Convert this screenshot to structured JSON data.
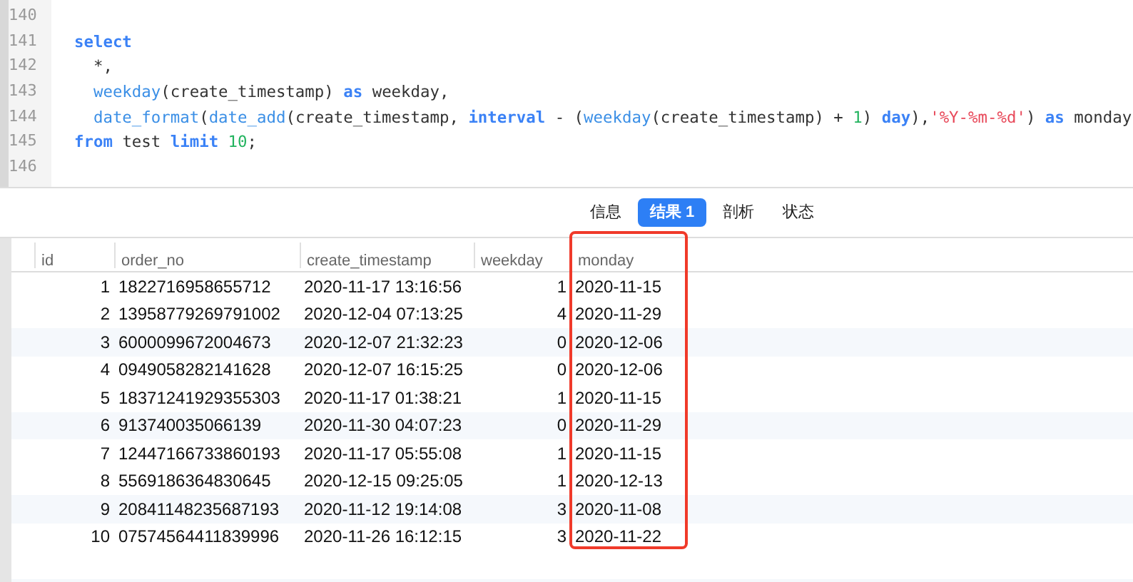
{
  "editor": {
    "lines": [
      {
        "number": "140"
      },
      {
        "number": "141",
        "tokens": [
          {
            "kind": "keyword",
            "text": "select"
          }
        ]
      },
      {
        "number": "142",
        "tokens": [
          {
            "kind": "plain",
            "text": "  *,"
          }
        ]
      },
      {
        "number": "143",
        "tokens": [
          {
            "kind": "function",
            "text": "  weekday"
          },
          {
            "kind": "plain",
            "text": "(create_timestamp) "
          },
          {
            "kind": "keyword",
            "text": "as"
          },
          {
            "kind": "plain",
            "text": " weekday,"
          }
        ]
      },
      {
        "number": "144",
        "tokens": [
          {
            "kind": "function",
            "text": "  date_format"
          },
          {
            "kind": "plain",
            "text": "("
          },
          {
            "kind": "function",
            "text": "date_add"
          },
          {
            "kind": "plain",
            "text": "(create_timestamp, "
          },
          {
            "kind": "keyword",
            "text": "interval"
          },
          {
            "kind": "plain",
            "text": " - ("
          },
          {
            "kind": "function",
            "text": "weekday"
          },
          {
            "kind": "plain",
            "text": "(create_timestamp) + "
          },
          {
            "kind": "number",
            "text": "1"
          },
          {
            "kind": "plain",
            "text": ") "
          },
          {
            "kind": "keyword",
            "text": "day"
          },
          {
            "kind": "plain",
            "text": "),"
          },
          {
            "kind": "string",
            "text": "'%Y-%m-%d'"
          },
          {
            "kind": "plain",
            "text": ") "
          },
          {
            "kind": "keyword",
            "text": "as"
          },
          {
            "kind": "plain",
            "text": " monday"
          }
        ]
      },
      {
        "number": "145",
        "tokens": [
          {
            "kind": "keyword",
            "text": "from"
          },
          {
            "kind": "plain",
            "text": " test "
          },
          {
            "kind": "keyword",
            "text": "limit"
          },
          {
            "kind": "number",
            "text": " 10"
          },
          {
            "kind": "plain",
            "text": ";"
          }
        ]
      },
      {
        "number": "146"
      }
    ]
  },
  "tabs": [
    {
      "label": "信息",
      "selected": false
    },
    {
      "label": "结果 1",
      "selected": true
    },
    {
      "label": "剖析",
      "selected": false
    },
    {
      "label": "状态",
      "selected": false
    }
  ],
  "table": {
    "columns": [
      {
        "label": "id",
        "highlighted": false
      },
      {
        "label": "order_no",
        "highlighted": false
      },
      {
        "label": "create_timestamp",
        "highlighted": false
      },
      {
        "label": "weekday",
        "highlighted": false
      },
      {
        "label": "monday",
        "highlighted": true
      }
    ],
    "rows": [
      [
        "1",
        "1822716958655712",
        "2020-11-17 13:16:56",
        "1",
        "2020-11-15"
      ],
      [
        "2",
        "13958779269791002",
        "2020-12-04 07:13:25",
        "4",
        "2020-11-29"
      ],
      [
        "3",
        "6000099672004673",
        "2020-12-07 21:32:23",
        "0",
        "2020-12-06"
      ],
      [
        "4",
        "0949058282141628",
        "2020-12-07 16:15:25",
        "0",
        "2020-12-06"
      ],
      [
        "5",
        "18371241929355303",
        "2020-11-17 01:38:21",
        "1",
        "2020-11-15"
      ],
      [
        "6",
        "913740035066139",
        "2020-11-30 04:07:23",
        "0",
        "2020-11-29"
      ],
      [
        "7",
        "12447166733860193",
        "2020-11-17 05:55:08",
        "1",
        "2020-11-15"
      ],
      [
        "8",
        "5569186364830645",
        "2020-12-15 09:25:05",
        "1",
        "2020-12-13"
      ],
      [
        "9",
        "20841148235687193",
        "2020-11-12 19:14:08",
        "3",
        "2020-11-08"
      ],
      [
        "10",
        "07574564411839996",
        "2020-11-26 16:12:15",
        "3",
        "2020-11-22"
      ]
    ]
  }
}
